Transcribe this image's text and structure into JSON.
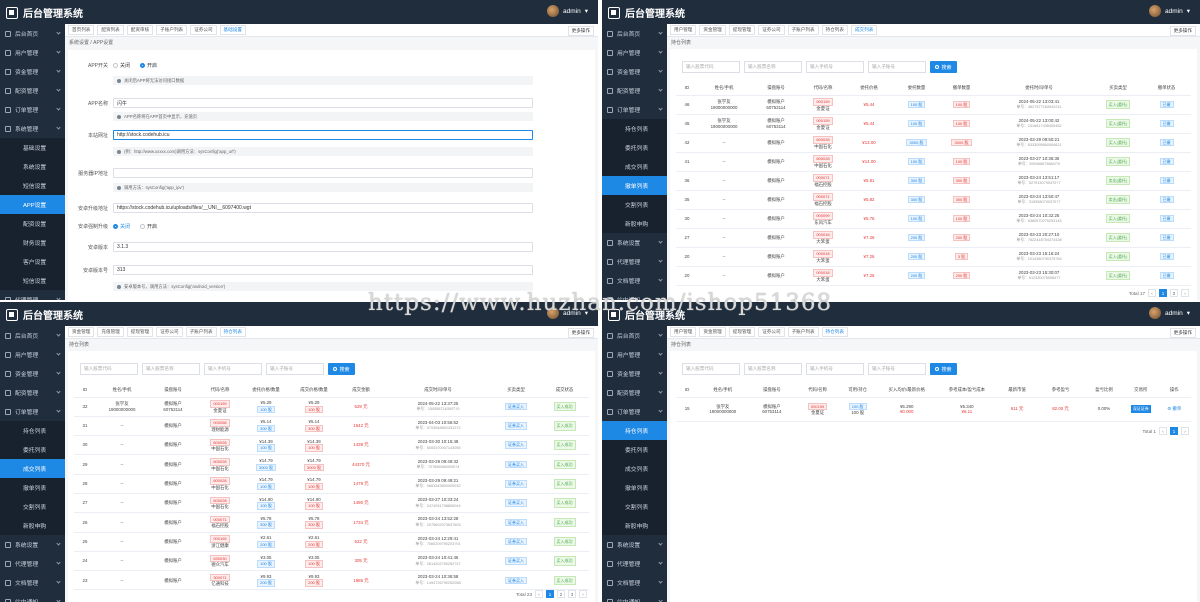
{
  "app": {
    "title": "后台管理系统",
    "user": "admin"
  },
  "panel1": {
    "sidebar": [
      {
        "label": "后台首页",
        "sub": false
      },
      {
        "label": "用户管理",
        "sub": false
      },
      {
        "label": "资金管理",
        "sub": false
      },
      {
        "label": "配资管理",
        "sub": false
      },
      {
        "label": "订单管理",
        "sub": false
      },
      {
        "label": "系统管理",
        "sub": false
      },
      {
        "label": "基础设置",
        "sub": true
      },
      {
        "label": "系统设置",
        "sub": true
      },
      {
        "label": "短信设置",
        "sub": true
      },
      {
        "label": "APP设置",
        "sub": true,
        "active": true
      },
      {
        "label": "配资设置",
        "sub": true
      },
      {
        "label": "财务设置",
        "sub": true
      },
      {
        "label": "客户设置",
        "sub": true
      },
      {
        "label": "短信设置",
        "sub": true
      },
      {
        "label": "代理管理",
        "sub": false
      },
      {
        "label": "文档管理",
        "sub": false
      }
    ],
    "tabs": [
      "首页列表",
      "配资列表",
      "配资审核",
      "子账户列表",
      "证券公司",
      "基础设置"
    ],
    "more": "更多操作",
    "breadcrumb": "系统设置 / APP设置",
    "fields": {
      "app_switch_label": "APP开关",
      "opt_off": "关闭",
      "opt_on": "开启",
      "app_switch_hint": "关闭后APP将无法访问接口数据",
      "app_name_label": "APP名称",
      "app_name_value": "闪牛",
      "app_name_hint": "APP名称将在APP首页中显示，充值页",
      "domain_label": "本站网址",
      "domain_value": "http://stock.codehub.icu",
      "domain_hint": "(例：http://www.xxxxx.com)调用方法：sysConfig('app_url')",
      "ip_label": "服务器IP地址",
      "ip_value": "",
      "ip_hint": "调用方法：sysConfig('app_ipv')",
      "android_url_label": "安卓升级地址",
      "android_url_value": "https://stock.codehub.icu/uploads/files/__UNI__6097400.wgt",
      "android_force_label": "安卓强制升级",
      "opt_off2": "关闭",
      "opt_on2": "开启",
      "android_ver_label": "安卓版本",
      "android_ver_value": "3.1.3",
      "android_code_label": "安卓版本号",
      "android_code_value": "313",
      "android_code_hint": "安卓版本号，调用方法：sysConfig('android_version')"
    }
  },
  "panel2": {
    "sidebar": [
      {
        "label": "后台首页",
        "sub": false
      },
      {
        "label": "用户管理",
        "sub": false
      },
      {
        "label": "资金管理",
        "sub": false
      },
      {
        "label": "配资管理",
        "sub": false
      },
      {
        "label": "订单管理",
        "sub": false
      },
      {
        "label": "持仓列表",
        "sub": true
      },
      {
        "label": "委托列表",
        "sub": true
      },
      {
        "label": "成交列表",
        "sub": true
      },
      {
        "label": "撤单列表",
        "sub": true,
        "active": true
      },
      {
        "label": "交割列表",
        "sub": true
      },
      {
        "label": "新股申购",
        "sub": true
      },
      {
        "label": "系统设置",
        "sub": false
      },
      {
        "label": "代理管理",
        "sub": false
      },
      {
        "label": "文档管理",
        "sub": false
      },
      {
        "label": "站内通知",
        "sub": false
      }
    ],
    "tabs": [
      "用户管理",
      "资金管理",
      "提现管理",
      "证券公司",
      "子账户列表",
      "持仓列表",
      "成交列表"
    ],
    "more": "更多操作",
    "breadcrumb": "持仓列表",
    "search": [
      "输入股票代码",
      "输入股票名称",
      "输入手机号",
      "输入子账号"
    ],
    "search_btn": "搜索",
    "headers": [
      "ID",
      "姓名/手机",
      "操盘账号",
      "代码/名称",
      "委托价格",
      "委托数量",
      "撤单数量",
      "委托时间/单号",
      "买卖类型",
      "撤单状态"
    ],
    "rows": [
      {
        "id": "46",
        "name": "张学友",
        "phone": "19000000000",
        "acct_a": "模拟账户",
        "acct_b": "60753114",
        "code": "000159",
        "sname": "金夏证",
        "price": "¥5.44",
        "qty": "100 股",
        "cqty": "100 股",
        "time": "2024-05-22 13:03:41",
        "no": "4627577162642211",
        "type": "买入(委托)",
        "status": "已撤"
      },
      {
        "id": "45",
        "name": "张学友",
        "phone": "19000000000",
        "acct_a": "模拟账户",
        "acct_b": "60753114",
        "code": "000159",
        "sname": "金夏证",
        "price": "¥5.44",
        "qty": "100 股",
        "cqty": "100 股",
        "time": "2024-05-22 13:00:42",
        "no": "2316817435400452",
        "type": "买入(委托)",
        "status": "已撤"
      },
      {
        "id": "42",
        "name": "--",
        "phone": "",
        "acct_a": "模拟账户",
        "acct_b": "",
        "code": "600028",
        "sname": "中国石化",
        "price": "¥13.00",
        "qty": "3000 股",
        "cqty": "3000 股",
        "time": "2023-03-29 09:50:21",
        "no": "6333095660064621",
        "type": "买入(委托)",
        "status": "已撤"
      },
      {
        "id": "41",
        "name": "--",
        "phone": "",
        "acct_a": "模拟账户",
        "acct_b": "",
        "code": "600028",
        "sname": "中国石化",
        "price": "¥14.00",
        "qty": "100 股",
        "cqty": "100 股",
        "time": "2023-03-27 10:36:36",
        "no": "5994666798847/0",
        "type": "买入(委托)",
        "status": "已撤"
      },
      {
        "id": "36",
        "name": "--",
        "phone": "",
        "acct_a": "模拟账户",
        "acct_b": "",
        "code": "000071",
        "sname": "福石控股",
        "price": "¥5.81",
        "qty": "300 股",
        "cqty": "300 股",
        "time": "2023-03-24 13:51:17",
        "no": "5279130790370?7",
        "type": "卖出(委托)",
        "status": "已撤"
      },
      {
        "id": "35",
        "name": "--",
        "phone": "",
        "acct_a": "模拟账户",
        "acct_b": "",
        "code": "000071",
        "sname": "福石控股",
        "price": "¥5.82",
        "qty": "300 股",
        "cqty": "300 股",
        "time": "2023-03-24 13:50:47",
        "no": "3153580790370?7",
        "type": "卖出(委托)",
        "status": "已撤"
      },
      {
        "id": "30",
        "name": "--",
        "phone": "",
        "acct_a": "模拟账户",
        "acct_b": "",
        "code": "000099",
        "sname": "东风汽车",
        "price": "¥5.76",
        "qty": "100 股",
        "cqty": "100 股",
        "time": "2023-03-24 10:32:25",
        "no": "5380570279253145",
        "type": "买入(委托)",
        "status": "已撤"
      },
      {
        "id": "27",
        "name": "--",
        "phone": "",
        "acct_a": "模拟账户",
        "acct_b": "",
        "code": "000018",
        "sname": "大笨蛋",
        "price": "¥7.26",
        "qty": "200 股",
        "cqty": "200 股",
        "time": "2023-03-23 20:27:10",
        "no": "7822418754374438",
        "type": "买入(委托)",
        "status": "已撤"
      },
      {
        "id": "20",
        "name": "--",
        "phone": "",
        "acct_a": "模拟账户",
        "acct_b": "",
        "code": "000018",
        "sname": "大笨蛋",
        "price": "¥7.26",
        "qty": "200 股",
        "cqty": "3 股",
        "time": "2023-03-23 15:16:24",
        "no": "1014360790375?54",
        "type": "买入(委托)",
        "status": "已撤"
      },
      {
        "id": "20",
        "name": "--",
        "phone": "",
        "acct_a": "模拟账户",
        "acct_b": "",
        "code": "000018",
        "sname": "大笨蛋",
        "price": "¥7.26",
        "qty": "200 股",
        "cqty": "200 股",
        "time": "2023-03-23 15:30:07",
        "no": "5123300750060?7",
        "type": "买入(委托)",
        "status": "已撤"
      }
    ],
    "total": "Total 17",
    "pages": [
      "1",
      "2"
    ]
  },
  "panel3": {
    "sidebar": [
      {
        "label": "后台首页",
        "sub": false
      },
      {
        "label": "用户管理",
        "sub": false
      },
      {
        "label": "资金管理",
        "sub": false
      },
      {
        "label": "配资管理",
        "sub": false
      },
      {
        "label": "订单管理",
        "sub": false
      },
      {
        "label": "持仓列表",
        "sub": true
      },
      {
        "label": "委托列表",
        "sub": true
      },
      {
        "label": "成交列表",
        "sub": true,
        "active": true
      },
      {
        "label": "撤单列表",
        "sub": true
      },
      {
        "label": "交割列表",
        "sub": true
      },
      {
        "label": "新股申购",
        "sub": true
      },
      {
        "label": "系统设置",
        "sub": false
      },
      {
        "label": "代理管理",
        "sub": false
      },
      {
        "label": "文档管理",
        "sub": false
      },
      {
        "label": "站内通知",
        "sub": false
      }
    ],
    "tabs": [
      "资金管理",
      "充值管理",
      "提现管理",
      "证券公司",
      "子账户列表",
      "持仓列表"
    ],
    "more": "更多操作",
    "breadcrumb": "持仓列表",
    "search": [
      "输入股票代码",
      "输入股票名称",
      "输入手机号",
      "输入子账号"
    ],
    "search_btn": "搜索",
    "headers": [
      "ID",
      "姓名/手机",
      "操盘账号",
      "代码/名称",
      "委托价格/数量",
      "成交价格/数量",
      "成交金额",
      "成交时间/单号",
      "买卖类型",
      "成交状态"
    ],
    "rows": [
      {
        "id": "32",
        "name": "张学友",
        "phone": "19000000000",
        "acct_a": "模拟账户",
        "acct_b": "60753114",
        "code": "000159",
        "sname": "金夏证",
        "p1": "¥5.29",
        "q1": "100 股",
        "p2": "¥5.29",
        "q2": "100 股",
        "amt": "529 元",
        "time": "2024-05-22 13:37:25",
        "no": "1505587163007?0",
        "type": "证券买入",
        "status": "买入成功"
      },
      {
        "id": "31",
        "name": "--",
        "phone": "",
        "acct_a": "模拟账户",
        "acct_b": "",
        "code": "000058",
        "sname": "理财能源",
        "p1": "¥5.14",
        "q1": "300 股",
        "p2": "¥5.14",
        "q2": "300 股",
        "amt": "1542 元",
        "time": "2023-04-03 10:56:52",
        "no": "0703948802431272",
        "type": "证券买入",
        "status": "买入成功"
      },
      {
        "id": "30",
        "name": "--",
        "phone": "",
        "acct_a": "模拟账户",
        "acct_b": "",
        "code": "600028",
        "sname": "中国石化",
        "p1": "¥14.39",
        "q1": "100 股",
        "p2": "¥14.39",
        "q2": "100 股",
        "amt": "1439 元",
        "time": "2023-03-30 10:15:48",
        "no": "5000370007143055",
        "type": "证券买入",
        "status": "买入成功"
      },
      {
        "id": "29",
        "name": "--",
        "phone": "",
        "acct_a": "模拟账户",
        "acct_b": "",
        "code": "600028",
        "sname": "中国石化",
        "p1": "¥14.79",
        "q1": "3000 股",
        "p2": "¥14.79",
        "q2": "3000 股",
        "amt": "44370 元",
        "time": "2023-03-29 09:49:32",
        "no": "7076565800000?4",
        "type": "证券买入",
        "status": "买入成功"
      },
      {
        "id": "28",
        "name": "--",
        "phone": "",
        "acct_a": "模拟账户",
        "acct_b": "",
        "code": "600028",
        "sname": "中国石化",
        "p1": "¥14.79",
        "q1": "100 股",
        "p2": "¥14.79",
        "q2": "100 股",
        "amt": "1479 元",
        "time": "2023-03-29 09:49:21",
        "no": "0663349800000032",
        "type": "证券买入",
        "status": "买入成功"
      },
      {
        "id": "27",
        "name": "--",
        "phone": "",
        "acct_a": "模拟账户",
        "acct_b": "",
        "code": "600028",
        "sname": "中国石化",
        "p1": "¥14.90",
        "q1": "100 股",
        "p2": "¥14.90",
        "q2": "100 股",
        "amt": "1490 元",
        "time": "2023-03-27 10:33:24",
        "no": "2474091798855044",
        "type": "证券买入",
        "status": "买入成功"
      },
      {
        "id": "26",
        "name": "--",
        "phone": "",
        "acct_a": "模拟账户",
        "acct_b": "",
        "code": "000071",
        "sname": "福石控股",
        "p1": "¥5.78",
        "q1": "300 股",
        "p2": "¥5.78",
        "q2": "300 股",
        "amt": "1734 元",
        "time": "2023-03-24 13:52:28",
        "no": "2075602073637603",
        "type": "证券买入",
        "status": "买入成功"
      },
      {
        "id": "25",
        "name": "--",
        "phone": "",
        "acct_a": "模拟账户",
        "acct_b": "",
        "code": "000165",
        "sname": "浙江健康",
        "p1": "¥2.61",
        "q1": "200 股",
        "p2": "¥2.61",
        "q2": "200 股",
        "amt": "522 元",
        "time": "2023-03-24 12:29:41",
        "no": "7060209790203?01",
        "type": "证券买入",
        "status": "买入成功"
      },
      {
        "id": "24",
        "name": "--",
        "phone": "",
        "acct_a": "模拟账户",
        "acct_b": "",
        "code": "630030",
        "sname": "德众汽车",
        "p1": "¥3.05",
        "q1": "100 股",
        "p2": "¥3.05",
        "q2": "100 股",
        "amt": "305 元",
        "time": "2023-03-24 10:41:46",
        "no": "2614202790252?27",
        "type": "证券买入",
        "status": "买入成功"
      },
      {
        "id": "23",
        "name": "--",
        "phone": "",
        "acct_a": "模拟账户",
        "acct_b": "",
        "code": "300071",
        "sname": "亿通科技",
        "p1": "¥9.93",
        "q1": "200 股",
        "p2": "¥9.93",
        "q2": "200 股",
        "amt": "1986 元",
        "time": "2023-03-24 10:36:58",
        "no": "1494726790252058",
        "type": "证券买入",
        "status": "买入成功"
      }
    ],
    "total": "Total 23",
    "pages": [
      "1",
      "2",
      "3"
    ]
  },
  "panel4": {
    "sidebar": [
      {
        "label": "后台首页",
        "sub": false
      },
      {
        "label": "用户管理",
        "sub": false
      },
      {
        "label": "资金管理",
        "sub": false
      },
      {
        "label": "配资管理",
        "sub": false
      },
      {
        "label": "订单管理",
        "sub": false
      },
      {
        "label": "持仓列表",
        "sub": true,
        "active": true
      },
      {
        "label": "委托列表",
        "sub": true
      },
      {
        "label": "成交列表",
        "sub": true
      },
      {
        "label": "撤单列表",
        "sub": true
      },
      {
        "label": "交割列表",
        "sub": true
      },
      {
        "label": "新股申购",
        "sub": true
      },
      {
        "label": "系统设置",
        "sub": false
      },
      {
        "label": "代理管理",
        "sub": false
      },
      {
        "label": "文档管理",
        "sub": false
      },
      {
        "label": "站内通知",
        "sub": false
      }
    ],
    "tabs": [
      "用户管理",
      "资金管理",
      "提现管理",
      "证券公司",
      "子账户列表",
      "持仓列表"
    ],
    "more": "更多操作",
    "breadcrumb": "持仓列表",
    "search": [
      "输入股票代码",
      "输入股票名称",
      "输入手机号",
      "输入子账号"
    ],
    "search_btn": "搜索",
    "headers": [
      "ID",
      "姓名/手机",
      "操盘账号",
      "代码/名称",
      "可用/持仓",
      "买入均价/最新价格",
      "参考成本/盈亏成本",
      "最新市值",
      "参考盈亏",
      "盈亏比例",
      "交易所",
      "操作"
    ],
    "rows": [
      {
        "id": "15",
        "name": "张学友",
        "phone": "19000000000",
        "acct_a": "模拟账户",
        "acct_b": "60753114",
        "code": "000159",
        "sname": "金夏证",
        "avail": "100 股",
        "hold": "100 股",
        "buy": "¥5.290",
        "last": "¥0.000",
        "cost": "¥5.340",
        "pcost": "¥6.11",
        "mv": "611 元",
        "pl": "82.00 元",
        "ratio": "0.00%",
        "ex": "深证证券",
        "op": "撤单"
      }
    ],
    "total": "Total 1",
    "pages": [
      "1"
    ]
  },
  "watermark": "https://www.huzhan.com/ishop51368"
}
